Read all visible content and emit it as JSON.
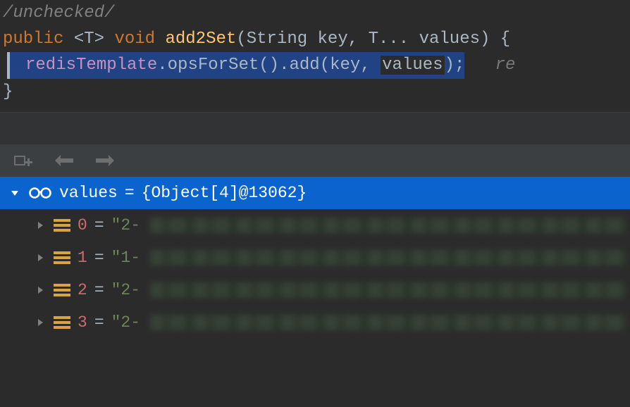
{
  "editor": {
    "comment": "/unchecked/",
    "line2": {
      "kw_public": "public",
      "type_param": "<T>",
      "kw_void": "void",
      "method": "add2Set",
      "p1_type": "String",
      "p1_name": "key",
      "p2_type": "T...",
      "p2_name": "values",
      "tail": ") {"
    },
    "line3": {
      "field": "redisTemplate",
      "call1": ".opsForSet().",
      "call2": "add",
      "open": "(",
      "arg1": "key",
      "comma": ", ",
      "arg2": "values",
      "close": ");",
      "hint": "re"
    },
    "line4": "}"
  },
  "debug": {
    "root": {
      "name": "values",
      "eq": "=",
      "type": "{Object[4]@13062}"
    },
    "items": [
      {
        "idx": "0",
        "eq": "=",
        "prefix": "\"2-"
      },
      {
        "idx": "1",
        "eq": "=",
        "prefix": "\"1-"
      },
      {
        "idx": "2",
        "eq": "=",
        "prefix": "\"2-"
      },
      {
        "idx": "3",
        "eq": "=",
        "prefix": "\"2-"
      }
    ]
  }
}
